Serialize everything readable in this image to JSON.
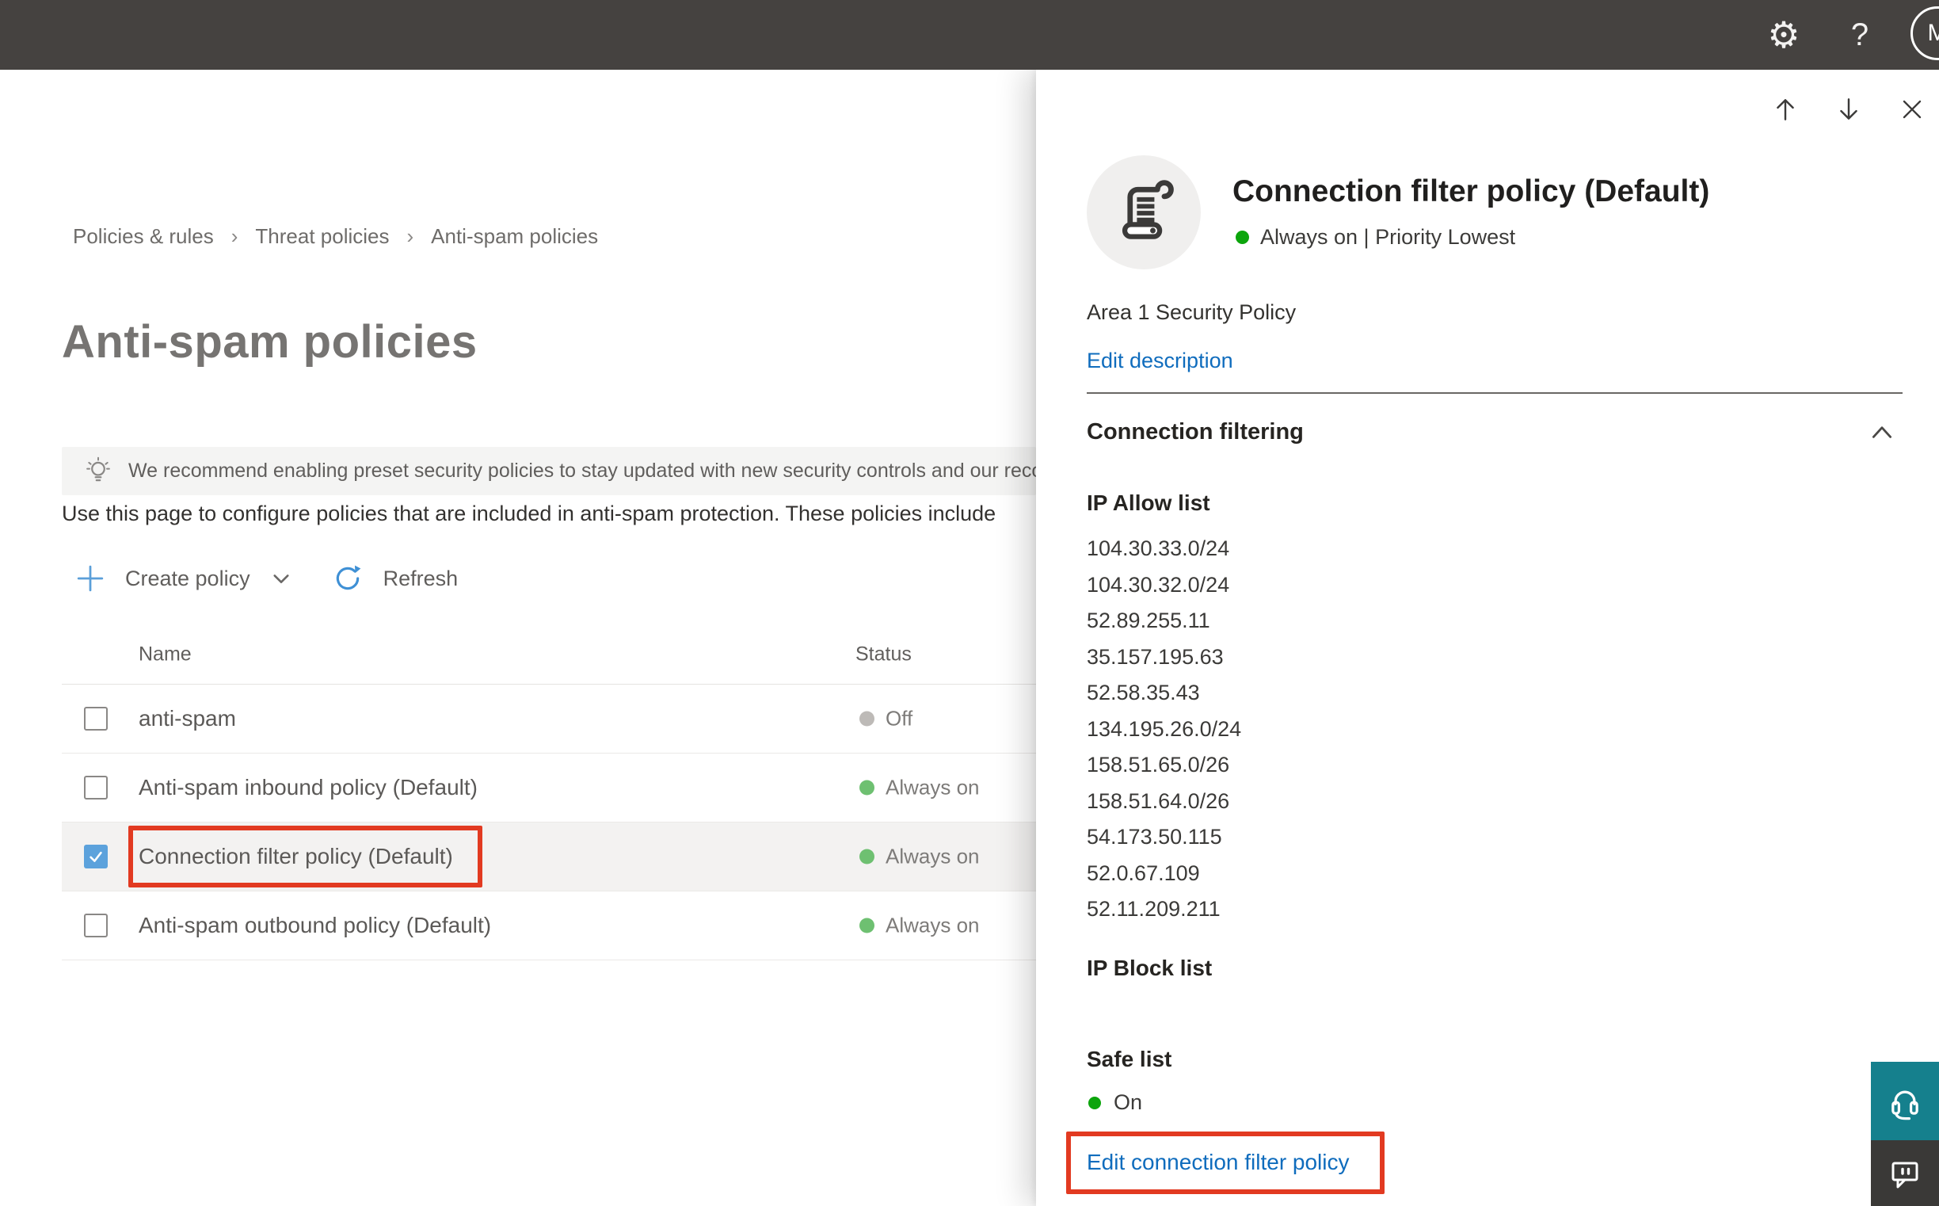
{
  "topbar": {
    "help_label": "?",
    "avatar_initial": "M"
  },
  "breadcrumb": {
    "separator": "›",
    "items": [
      "Policies & rules",
      "Threat policies",
      "Anti-spam policies"
    ]
  },
  "page": {
    "title": "Anti-spam policies",
    "banner_text": "We recommend enabling preset security policies to stay updated with new security controls and our recommen",
    "intro_text": "Use this page to configure policies that are included in anti-spam protection. These policies include",
    "create_policy_label": "Create policy",
    "refresh_label": "Refresh"
  },
  "table": {
    "columns": {
      "name": "Name",
      "status": "Status"
    },
    "rows": [
      {
        "name": "anti-spam",
        "status": "Off",
        "checked": false,
        "selected": false,
        "annotated": false
      },
      {
        "name": "Anti-spam inbound policy (Default)",
        "status": "Always on",
        "checked": false,
        "selected": false,
        "annotated": false
      },
      {
        "name": "Connection filter policy (Default)",
        "status": "Always on",
        "checked": true,
        "selected": true,
        "annotated": true
      },
      {
        "name": "Anti-spam outbound policy (Default)",
        "status": "Always on",
        "checked": false,
        "selected": false,
        "annotated": false
      }
    ]
  },
  "panel": {
    "title": "Connection filter policy (Default)",
    "status_line": "Always on | Priority Lowest",
    "description": "Area 1 Security Policy",
    "edit_description_label": "Edit description",
    "section_title": "Connection filtering",
    "ip_allow_title": "IP Allow list",
    "ip_allow_list": [
      "104.30.33.0/24",
      "104.30.32.0/24",
      "52.89.255.11",
      "35.157.195.63",
      "52.58.35.43",
      "134.195.26.0/24",
      "158.51.65.0/26",
      "158.51.64.0/26",
      "54.173.50.115",
      "52.0.67.109",
      "52.11.209.211"
    ],
    "ip_block_title": "IP Block list",
    "safe_list_title": "Safe list",
    "safe_list_status": "On",
    "edit_link_label": "Edit connection filter policy"
  },
  "icons": {
    "gear-icon": "⚙",
    "help-icon": "?",
    "scroll-icon": "svg-scroll",
    "lightbulb-icon": "svg-lightbulb",
    "plus-icon": "svg-plus",
    "chevron-down-icon": "svg-chevron-down",
    "chevron-up-icon": "svg-chevron-up",
    "refresh-icon": "svg-refresh",
    "up-arrow-icon": "svg-up-arrow",
    "down-arrow-icon": "svg-down-arrow",
    "close-icon": "svg-close",
    "checkmark-icon": "svg-check",
    "headset-icon": "svg-headset",
    "feedback-icon": "svg-speech-bubble"
  },
  "colors": {
    "topbar_bg": "#454240",
    "link_blue": "#0f6cbd",
    "annotation_red": "#e23a21",
    "panel_status_green": "#0ca50c",
    "table_status_green": "#6ec071",
    "status_off_gray": "#bdbab7",
    "checkbox_checked_blue": "#5ca2dc",
    "selected_row_bg": "#f3f2f1",
    "support_teal": "#15808d",
    "feedback_dark": "#3a3937"
  }
}
